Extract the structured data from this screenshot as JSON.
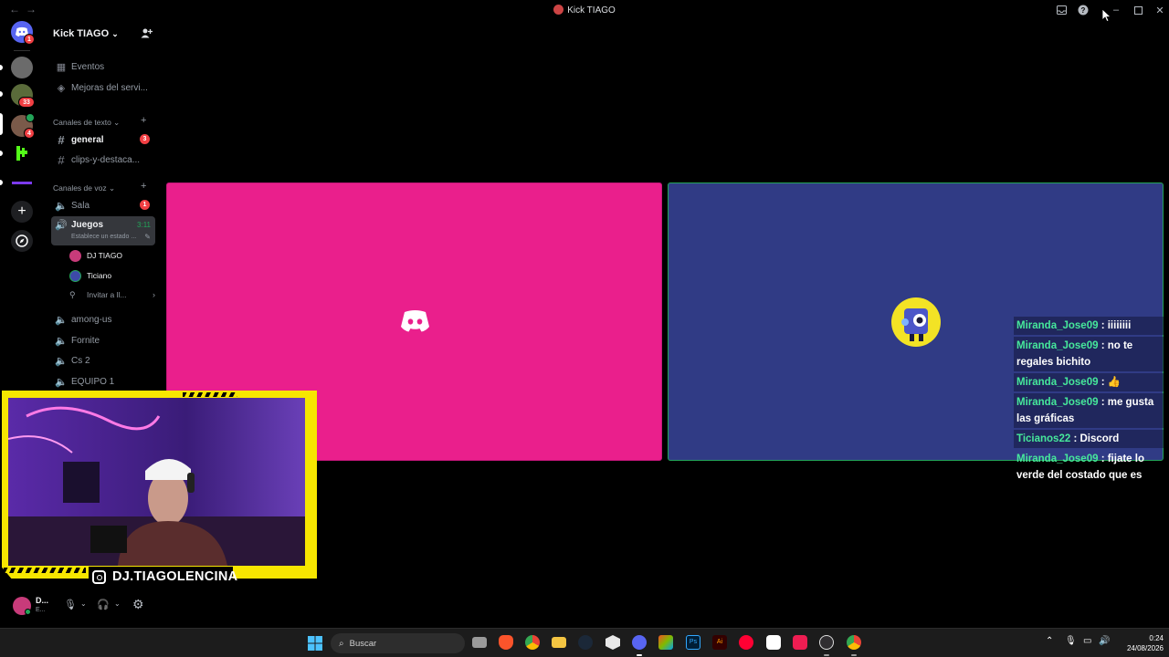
{
  "window": {
    "title": "Kick TIAGO",
    "back_icon": "arrow-left-icon",
    "forward_icon": "arrow-right-icon"
  },
  "server": {
    "name": "Kick TIAGO",
    "dropdown_icon": "chevron-down-icon",
    "invite_icon": "add-member-icon"
  },
  "rail": {
    "home_badge": "1",
    "server2_badge": "33",
    "server3_badge": "4"
  },
  "sidebar": {
    "events_label": "Eventos",
    "boost_label": "Mejoras del servi...",
    "text_category": "Canales de texto",
    "text_channels": [
      {
        "name": "general",
        "badge": "3"
      },
      {
        "name": "clips-y-destaca..."
      }
    ],
    "voice_category": "Canales de voz",
    "voice_channels": [
      {
        "name": "Sala",
        "badge": "1"
      },
      {
        "name": "Juegos",
        "timer": "3:11",
        "status": "Establece un estado ..."
      },
      {
        "name": "among-us"
      },
      {
        "name": "Fornite"
      },
      {
        "name": "Cs 2"
      },
      {
        "name": "EQUIPO 1"
      }
    ],
    "voice_users": [
      {
        "name": "DJ TIAGO"
      },
      {
        "name": "Ticiano"
      }
    ],
    "invite_label": "Invitar a ll..."
  },
  "user_panel": {
    "name": "D...",
    "status": "E..."
  },
  "webcam": {
    "handle": "DJ.TIAGOLENCINA"
  },
  "chat": [
    {
      "user": "Miranda_Jose09",
      "text": ": iiiiiiii"
    },
    {
      "user": "Miranda_Jose09",
      "text": ": no te regales bichito"
    },
    {
      "user": "Miranda_Jose09",
      "text": ": 👍"
    },
    {
      "user": "Miranda_Jose09",
      "text": ": me gusta las gráficas"
    },
    {
      "user": "Ticianos22",
      "text": ": Discord"
    },
    {
      "user": "Miranda_Jose09",
      "text": ": fijate lo verde del costado que es"
    }
  ],
  "taskbar": {
    "search_label": "Buscar",
    "time": "0:24",
    "date": "24/08/2026"
  },
  "colors": {
    "tile1_bg": "#ea1f8c",
    "tile2_bg": "#303b85",
    "speaking_border": "#23a559",
    "chat_name": "#46e89b",
    "webcam_frame": "#f7e600",
    "badge": "#f23f43"
  }
}
